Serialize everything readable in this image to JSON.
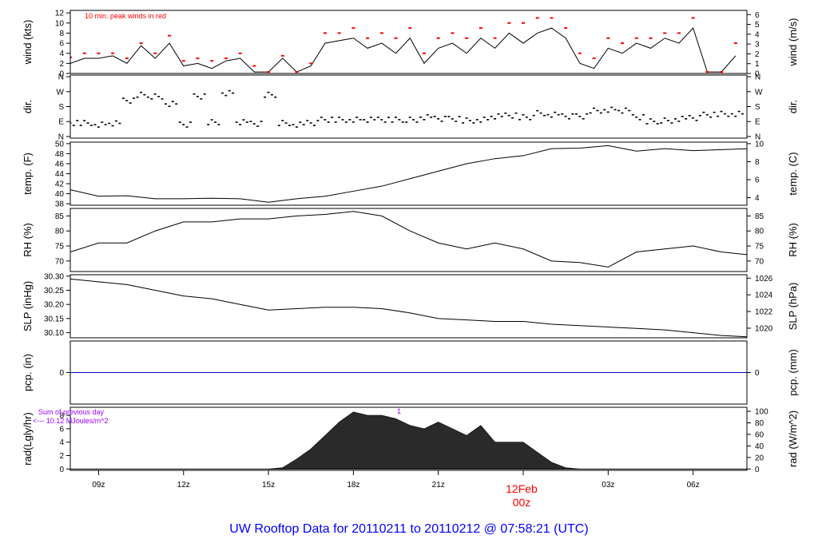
{
  "title": "UW Rooftop Data for 20110211  to  20110212 @ 07:58:21  (UTC)",
  "colors": {
    "title": "#0000ff",
    "gust": "#ff0000",
    "pcp_line": "#0000cc",
    "annotation": "#9900ff",
    "date_label": "#ff0000",
    "line": "#000000"
  },
  "x_axis": {
    "range_hours": [
      8.0,
      31.9
    ],
    "ticks": [
      {
        "t": 9,
        "label": "09z"
      },
      {
        "t": 12,
        "label": "12z"
      },
      {
        "t": 15,
        "label": "15z"
      },
      {
        "t": 18,
        "label": "18z"
      },
      {
        "t": 21,
        "label": "21z"
      },
      {
        "t": 24,
        "label": "00z"
      },
      {
        "t": 27,
        "label": "03z"
      },
      {
        "t": 30,
        "label": "06z"
      }
    ],
    "date_label": "12Feb",
    "date_time_label": "00z"
  },
  "chart_data": [
    {
      "type": "line",
      "name": "wind",
      "ylabel": "wind (kts)",
      "ylabel_right": "wind (m/s)",
      "ylim": [
        0,
        12.5
      ],
      "yticks": [
        0,
        2,
        4,
        6,
        8,
        10,
        12
      ],
      "yticks_right": [
        {
          "v": 0,
          "label": "0"
        },
        {
          "v": 1.944,
          "label": "1"
        },
        {
          "v": 3.888,
          "label": "2"
        },
        {
          "v": 5.832,
          "label": "3"
        },
        {
          "v": 7.776,
          "label": "4"
        },
        {
          "v": 9.72,
          "label": "5"
        },
        {
          "v": 11.664,
          "label": "6"
        }
      ],
      "annotation": "10 min. peak winds in red",
      "t_start": 8.0,
      "t_step": 0.5,
      "values": [
        2,
        3,
        3,
        3.5,
        2,
        5.5,
        3,
        6,
        1.5,
        2,
        1,
        2.5,
        3,
        0.3,
        0.3,
        3,
        0.3,
        1.5,
        6,
        6.5,
        7,
        5,
        6,
        4,
        7,
        2,
        5,
        6,
        4,
        7,
        5,
        8,
        6,
        8,
        9,
        7,
        2,
        1,
        5,
        4,
        6,
        5,
        7,
        6,
        9,
        0.3,
        0.3,
        3.5
      ],
      "gusts": [
        3.2,
        4,
        4,
        4,
        3,
        6,
        4,
        7.5,
        2.5,
        3,
        2.5,
        3,
        4,
        1.5,
        0.3,
        3.5,
        0.3,
        2,
        8,
        8,
        9,
        7,
        8,
        7,
        9,
        4,
        7,
        8,
        7,
        9,
        7,
        10,
        10,
        11,
        11,
        9,
        4,
        3,
        7,
        6,
        7,
        7,
        8,
        8,
        11,
        0.3,
        0.3,
        6
      ]
    },
    {
      "type": "scatter",
      "name": "dir",
      "ylabel": "dir.",
      "ylabel_right": "dir.",
      "ylim": [
        -10,
        370
      ],
      "yticks": [
        {
          "v": 0,
          "label": "N"
        },
        {
          "v": 90,
          "label": "E"
        },
        {
          "v": 180,
          "label": "S"
        },
        {
          "v": 270,
          "label": "W"
        },
        {
          "v": 360,
          "label": "N"
        }
      ],
      "t_start": 8.0,
      "t_step": 0.5,
      "values": [
        80,
        85,
        80,
        78,
        220,
        260,
        240,
        200,
        80,
        240,
        90,
        270,
        85,
        80,
        260,
        80,
        75,
        90,
        100,
        105,
        110,
        100,
        105,
        110,
        100,
        120,
        115,
        105,
        100,
        110,
        120,
        130,
        125,
        140,
        135,
        130,
        120,
        160,
        170,
        155,
        120,
        100,
        95,
        110,
        120,
        130,
        140,
        145
      ]
    },
    {
      "type": "line",
      "name": "temp",
      "ylabel": "temp. (F)",
      "ylabel_right": "temp. (C)",
      "ylim": [
        37.7,
        50.3
      ],
      "yticks": [
        38,
        40,
        42,
        44,
        46,
        48,
        50
      ],
      "yticks_right": [
        {
          "v": 39.2,
          "label": "4"
        },
        {
          "v": 42.8,
          "label": "6"
        },
        {
          "v": 46.4,
          "label": "8"
        },
        {
          "v": 50,
          "label": "10"
        }
      ],
      "t_start": 8.0,
      "t_step": 1,
      "values": [
        40.8,
        39.5,
        39.6,
        39,
        39,
        39.1,
        39,
        38.3,
        39,
        39.5,
        40.5,
        41.5,
        43,
        44.5,
        46,
        47,
        47.6,
        49,
        49.1,
        49.6,
        48.5,
        49,
        48.6,
        48.8,
        49
      ]
    },
    {
      "type": "line",
      "name": "RH",
      "ylabel": "RH (%)",
      "ylabel_right": "RH (%)",
      "ylim": [
        66.5,
        87.5
      ],
      "yticks": [
        70,
        75,
        80,
        85
      ],
      "yticks_right": [
        {
          "v": 70,
          "label": "70"
        },
        {
          "v": 75,
          "label": "75"
        },
        {
          "v": 80,
          "label": "80"
        },
        {
          "v": 85,
          "label": "85"
        }
      ],
      "t_start": 8.0,
      "t_step": 1,
      "values": [
        73,
        76,
        76,
        80,
        83,
        83,
        84,
        84,
        85,
        85.5,
        86.5,
        85,
        80,
        76,
        74,
        76,
        74,
        70,
        69.5,
        68,
        73,
        74,
        75,
        73,
        72
      ]
    },
    {
      "type": "line",
      "name": "SLP",
      "ylabel": "SLP (inHg)",
      "ylabel_right": "SLP (hPa)",
      "ylim": [
        30.082,
        30.305
      ],
      "yticks": [
        {
          "v": 30.1,
          "label": "30.10"
        },
        {
          "v": 30.15,
          "label": "30.15"
        },
        {
          "v": 30.2,
          "label": "30.20"
        },
        {
          "v": 30.25,
          "label": "30.25"
        },
        {
          "v": 30.3,
          "label": "30.30"
        }
      ],
      "yticks_right": [
        {
          "v": 30.116,
          "label": "1020"
        },
        {
          "v": 30.175,
          "label": "1022"
        },
        {
          "v": 30.234,
          "label": "1024"
        },
        {
          "v": 30.293,
          "label": "1026"
        }
      ],
      "t_start": 8.0,
      "t_step": 1,
      "values": [
        30.29,
        30.28,
        30.27,
        30.25,
        30.23,
        30.22,
        30.2,
        30.18,
        30.185,
        30.19,
        30.19,
        30.185,
        30.17,
        30.15,
        30.145,
        30.14,
        30.14,
        30.13,
        30.125,
        30.12,
        30.115,
        30.11,
        30.1,
        30.09,
        30.085
      ]
    },
    {
      "type": "line",
      "name": "pcp",
      "ylabel": "pcp. (in)",
      "ylabel_right": "pcp. (mm)",
      "ylim": [
        -1,
        1
      ],
      "yticks": [
        {
          "v": 0,
          "label": "0"
        }
      ],
      "yticks_right": [
        {
          "v": 0,
          "label": "0"
        }
      ],
      "t_start": 8.0,
      "t_step": 24,
      "values": [
        0,
        0
      ]
    },
    {
      "type": "area",
      "name": "rad",
      "ylabel": "rad(Lgly/hr)",
      "ylabel_right": "rad (W/m^2)",
      "ylim": [
        -0.2,
        9.2
      ],
      "yticks": [
        0,
        2,
        4,
        6,
        8
      ],
      "yticks_right": [
        {
          "v": 0,
          "label": "0"
        },
        {
          "v": 1.72,
          "label": "20"
        },
        {
          "v": 3.44,
          "label": "40"
        },
        {
          "v": 5.16,
          "label": "60"
        },
        {
          "v": 6.88,
          "label": "80"
        },
        {
          "v": 8.6,
          "label": "100"
        }
      ],
      "annotation_line1": "Sum of previous day",
      "annotation_line2": "<--- 10.12 MJoules/m^2",
      "marker": "1",
      "t_start": 15.0,
      "t_step": 0.5,
      "values": [
        0,
        0.2,
        1.5,
        3,
        5,
        7,
        8.5,
        8,
        8,
        7.5,
        6.5,
        6,
        7,
        6,
        5,
        6.5,
        4,
        4,
        4,
        2.5,
        1,
        0.2,
        0
      ]
    }
  ]
}
